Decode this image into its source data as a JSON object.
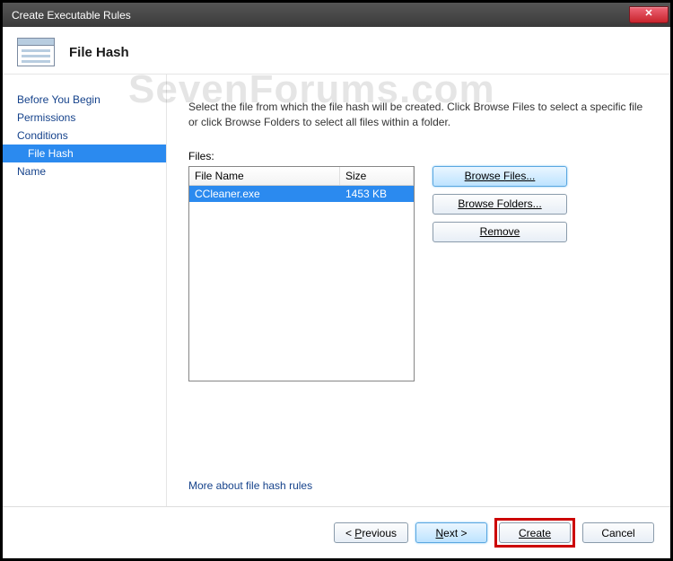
{
  "window": {
    "title": "Create Executable Rules"
  },
  "watermark": "SevenForums.com",
  "header": {
    "title": "File Hash"
  },
  "sidebar": {
    "items": [
      {
        "label": "Before You Begin"
      },
      {
        "label": "Permissions"
      },
      {
        "label": "Conditions"
      },
      {
        "label": "File Hash",
        "selected": true
      },
      {
        "label": "Name"
      }
    ]
  },
  "content": {
    "instruction": "Select the file from which the file hash will be created. Click Browse Files to select a specific file or click Browse Folders to select all files within a folder.",
    "files_label": "Files:",
    "columns": {
      "name": "File Name",
      "size": "Size"
    },
    "rows": [
      {
        "name": "CCleaner.exe",
        "size": "1453 KB"
      }
    ],
    "buttons": {
      "browse_files": "Browse Files...",
      "browse_folders": "Browse Folders...",
      "remove": "Remove"
    },
    "more_link": "More about file hash rules"
  },
  "footer": {
    "previous_pre": "< ",
    "previous_u": "P",
    "previous_post": "revious",
    "next_pre": "",
    "next_u": "N",
    "next_post": "ext >",
    "create": "Create",
    "cancel": "Cancel"
  }
}
